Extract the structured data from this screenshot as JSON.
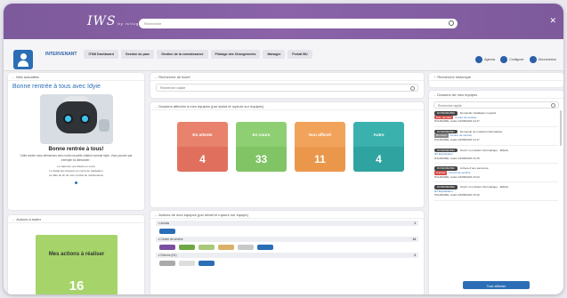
{
  "app": {
    "logo": "IWS",
    "logo_by": "by isilog"
  },
  "topbar": {
    "search_placeholder": "Recherche"
  },
  "nav": {
    "active_tab": "INTERVENANT",
    "tabs": [
      "ITSM Dashboard",
      "Gestion du parc",
      "Gestion de la connaissance",
      "Pilotage des Changements",
      "Manager",
      "Portail BU"
    ],
    "actions": [
      "Agenda",
      "Configurer",
      "Déconnexion"
    ]
  },
  "actualites": {
    "title": "Mes actualités",
    "headline": "Bonne rentrée à tous avec Idyie",
    "subhead": "Bonne rentrée à tous!",
    "text": "Cette année nous démarrons avec notre nouvelle chatbot nommé Idyie. Vous pouvez par exemple lui demander :",
    "list": [
      "Le statut de vos tickets en cours",
      "Le détail des dossiers en cours de réalisation",
      "La date de fin de mon contrat de maintenance"
    ]
  },
  "actions_traiter": {
    "title": "Actions à traiter",
    "box_label": "Mes actions à réaliser",
    "count": "16"
  },
  "recherche": {
    "title": "Recherche de ticket",
    "placeholder": "Recherche rapide"
  },
  "dossiers": {
    "title": "Dossiers affectés à mes équipes (par statut et rupture sur équipes)",
    "cards": [
      {
        "label": "En attente",
        "value": "4",
        "top": "#e8826d",
        "bot": "#e8826d"
      },
      {
        "label": "En cours",
        "value": "33",
        "top": "#8fcf74",
        "bot": "#8fcf74"
      },
      {
        "label": "Non affecté",
        "value": "11",
        "top": "#f2a35b",
        "bot": "#f2a35b"
      },
      {
        "label": "Autre",
        "value": "4",
        "top": "#3ab1ad",
        "bot": "#3ab1ad"
      }
    ]
  },
  "equipes": {
    "title": "Actions de mes équipes (par détail et rupture sur équipe)",
    "groups": [
      {
        "name": "Achats",
        "count": "1",
        "chips": [
          "#2b6eb5"
        ]
      },
      {
        "name": "Centre de service",
        "count": "14",
        "chips": [
          "#7a4fa0",
          "#6ea845",
          "#a8c97a",
          "#d9b16a",
          "#c8c8c8",
          "#2b6eb5"
        ]
      },
      {
        "name": "Externe (N1)",
        "count": "3",
        "chips": [
          "#aaaaaa",
          "#dddddd",
          "#2b6eb5"
        ]
      }
    ]
  },
  "historique": {
    "title": "Recherche historique"
  },
  "equipes_dossiers": {
    "title": "Dossiers de mes équipes",
    "placeholder": "Recherche rapide",
    "tickets": [
      {
        "id": "DOS00002696",
        "title": "Demande installation Logiciel",
        "badge": "Prio. de haut",
        "group": "Centre de service",
        "user": "HAUMAIRE, Anaïs",
        "date": "24/08/2023 10:17"
      },
      {
        "id": "DOS00002697",
        "title": "Demande de matériel informatique",
        "badge": "En cours",
        "group": "Centre de service",
        "user": "HAUMAIRE, Anaïs",
        "date": "24/08/2023 10:17"
      },
      {
        "id": "DOS00002694",
        "title": "Ouvrir un incident informatique - Mdpho",
        "badge": "",
        "group": "N2 Exploitation",
        "user": "HAUMAIRE, Anaïs",
        "date": "23/08/2023 16:15"
      },
      {
        "id": "DOS00002693",
        "title": "Arrivée d'une personne",
        "badge": "A arrivé",
        "group": "Centre de service",
        "user": "HAUMAIRE, Anaïs",
        "date": "23/08/2023 15:24"
      },
      {
        "id": "DOS00002692",
        "title": "Ouvrir un incident informatique - Mdpho",
        "badge": "",
        "group": "N2 Exploitation",
        "user": "HAUMAIRE, Anaïs",
        "date": "23/08/2023 15:16"
      }
    ],
    "button": "Tout afficher"
  }
}
